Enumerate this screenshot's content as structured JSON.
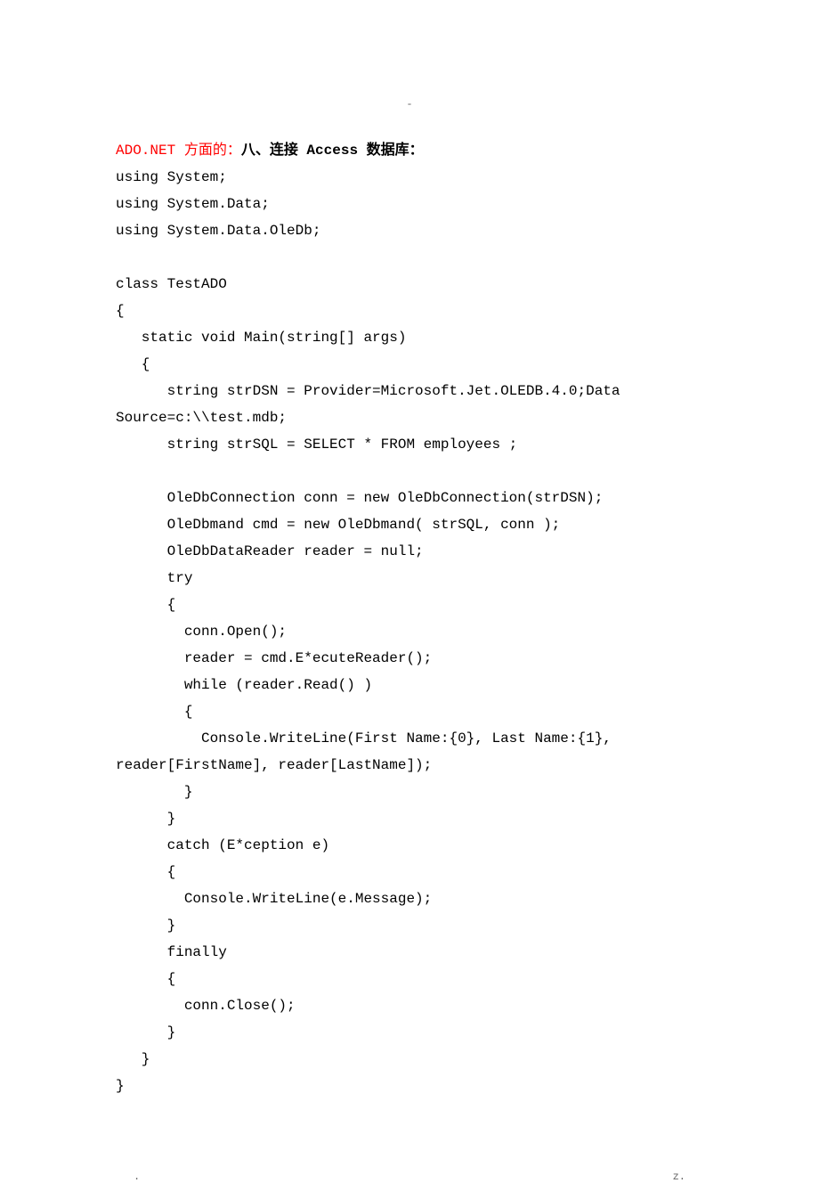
{
  "header_dash": "-",
  "title_prefix": "ADO.NET 方面的：",
  "title_bold": "八、连接 Access 数据库：",
  "lines": [
    "using System;",
    "using System.Data;",
    "using System.Data.OleDb;",
    "",
    "class TestADO",
    "{",
    "   static void Main(string[] args)",
    "   {",
    "      string strDSN = Provider=Microsoft.Jet.OLEDB.4.0;Data ",
    "Source=c:\\\\test.mdb;",
    "      string strSQL = SELECT * FROM employees ;",
    "",
    "      OleDbConnection conn = new OleDbConnection(strDSN);",
    "      OleDbmand cmd = new OleDbmand( strSQL, conn );",
    "      OleDbDataReader reader = null;",
    "      try",
    "      {",
    "        conn.Open();",
    "        reader = cmd.E*ecuteReader();",
    "        while (reader.Read() )",
    "        {",
    "          Console.WriteLine(First Name:{0}, Last Name:{1}, ",
    "reader[FirstName], reader[LastName]);",
    "        }",
    "      }",
    "      catch (E*ception e)",
    "      {",
    "        Console.WriteLine(e.Message);",
    "      }",
    "      finally",
    "      {",
    "        conn.Close();",
    "      }",
    "   }",
    "}"
  ],
  "footer_left": ".",
  "footer_right": "z."
}
